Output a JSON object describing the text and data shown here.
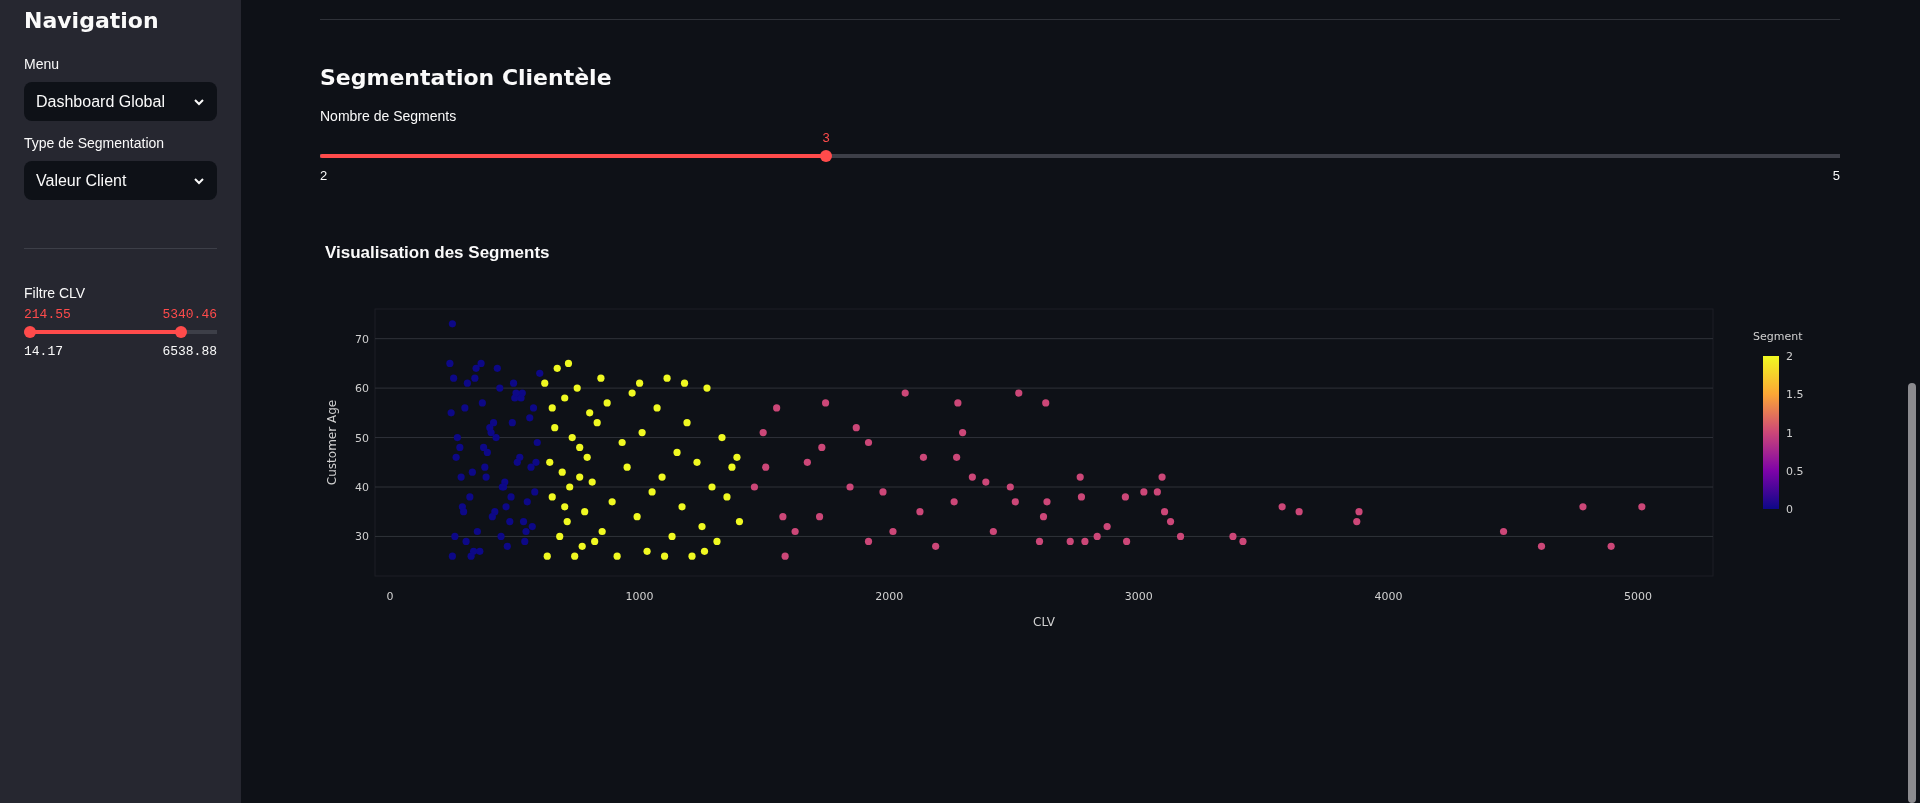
{
  "sidebar": {
    "title": "Navigation",
    "selects": [
      {
        "label": "Menu",
        "value": "Dashboard Global"
      },
      {
        "label": "Type de Segmentation",
        "value": "Valeur Client"
      }
    ],
    "range_slider": {
      "label": "Filtre CLV",
      "low_value": "214.55",
      "high_value": "5340.46",
      "low": {
        "level": 0.031
      },
      "high": {
        "level": 0.816
      },
      "min": "14.17",
      "max": "6538.88"
    }
  },
  "main": {
    "heading": "Segmentation Clientèle",
    "slider": {
      "label": "Nombre de Segments",
      "value": "3",
      "level": 0.333,
      "min": "2",
      "max": "5"
    },
    "colorbar": {
      "title": "Segment",
      "ticks": [
        "2",
        "1.5",
        "1",
        "0.5",
        "0"
      ]
    },
    "chart_data": {
      "type": "scatter",
      "title": "Visualisation des Segments",
      "xlabel": "CLV",
      "ylabel": "Customer Age",
      "xlim": [
        -60,
        5300
      ],
      "ylim": [
        22,
        76
      ],
      "grid": true,
      "xticks": [
        0,
        1000,
        2000,
        3000,
        4000,
        5000
      ],
      "yticks": [
        30,
        40,
        50,
        60,
        70
      ],
      "series": [
        {
          "color": "#0d0887",
          "x": [
            240,
            260,
            280,
            300,
            320,
            340,
            360,
            380,
            400,
            420,
            440,
            460,
            480,
            500,
            520,
            540,
            560,
            580,
            600,
            250,
            270,
            290,
            310,
            330,
            350,
            370,
            390,
            410,
            430,
            450,
            470,
            490,
            510,
            530,
            550,
            570,
            590,
            245,
            285,
            325,
            365,
            405,
            445,
            485,
            525,
            565,
            255,
            295,
            335,
            375,
            415,
            455,
            495,
            535,
            575,
            265,
            305,
            345,
            385,
            425,
            465,
            505,
            545,
            585,
            250
          ],
          "values": [
            65,
            30,
            48,
            56,
            38,
            62,
            27,
            44,
            52,
            35,
            60,
            41,
            33,
            58,
            46,
            29,
            54,
            39,
            63,
            26,
            50,
            36,
            61,
            43,
            31,
            57,
            47,
            34,
            64,
            40,
            28,
            53,
            45,
            59,
            37,
            32,
            49,
            55,
            42,
            26,
            65,
            51,
            30,
            38,
            58,
            44,
            62,
            35,
            27,
            48,
            53,
            40,
            61,
            33,
            56,
            46,
            29,
            64,
            42,
            50,
            36,
            59,
            31,
            45,
            73
          ]
        },
        {
          "color": "#f0f921",
          "x": [
            620,
            640,
            660,
            680,
            700,
            720,
            740,
            760,
            780,
            800,
            630,
            650,
            670,
            690,
            710,
            730,
            750,
            770,
            790,
            810,
            830,
            850,
            870,
            890,
            910,
            930,
            950,
            970,
            990,
            1010,
            1030,
            1050,
            1070,
            1090,
            1110,
            1130,
            1150,
            1170,
            1190,
            1210,
            1230,
            1250,
            1270,
            1290,
            1310,
            1330,
            1350,
            1370,
            1390,
            1400,
            715,
            845,
            1000,
            1100,
            1180,
            1260,
            650,
            700,
            760,
            820
          ],
          "values": [
            61,
            45,
            52,
            30,
            58,
            40,
            26,
            48,
            35,
            55,
            26,
            38,
            64,
            43,
            33,
            50,
            60,
            28,
            46,
            41,
            53,
            31,
            57,
            37,
            26,
            49,
            44,
            59,
            34,
            51,
            27,
            39,
            56,
            42,
            62,
            30,
            47,
            36,
            53,
            26,
            45,
            32,
            60,
            40,
            29,
            50,
            38,
            44,
            46,
            33,
            65,
            62,
            61,
            26,
            61,
            27,
            56,
            36,
            42,
            29
          ]
        },
        {
          "color": "#cc4778",
          "x": [
            1460,
            1495,
            1505,
            1549,
            1574,
            1583,
            1623,
            1672,
            1721,
            1730,
            1745,
            1843,
            1868,
            1917,
            1917,
            1975,
            2015,
            2064,
            2123,
            2137,
            2186,
            2260,
            2270,
            2275,
            2294,
            2333,
            2387,
            2417,
            2485,
            2505,
            2519,
            2602,
            2618,
            2627,
            2632,
            2725,
            2765,
            2770,
            2784,
            2833,
            2873,
            2946,
            2951,
            3020,
            3074,
            3093,
            3103,
            3127,
            3167,
            3377,
            3417,
            3574,
            3642,
            3873,
            3882,
            4461,
            4613,
            4779,
            4892,
            5015
          ],
          "values": [
            40,
            51,
            44,
            56,
            34,
            26,
            31,
            45,
            34,
            48,
            57,
            40,
            52,
            49,
            29,
            39,
            31,
            59,
            35,
            46,
            28,
            37,
            46,
            57,
            51,
            42,
            41,
            31,
            40,
            37,
            59,
            29,
            34,
            57,
            37,
            29,
            42,
            38,
            29,
            30,
            32,
            38,
            29,
            39,
            39,
            42,
            35,
            33,
            30,
            30,
            29,
            36,
            35,
            33,
            35,
            31,
            28,
            36,
            28,
            36
          ]
        }
      ]
    }
  }
}
